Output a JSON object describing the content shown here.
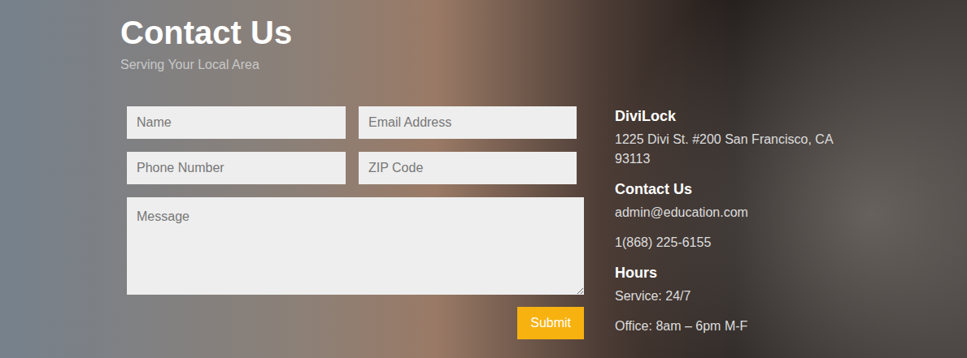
{
  "heading": {
    "title": "Contact Us",
    "subtitle": "Serving Your Local Area"
  },
  "form": {
    "fields": [
      {
        "placeholder": "Name"
      },
      {
        "placeholder": "Email Address"
      },
      {
        "placeholder": "Phone Number"
      },
      {
        "placeholder": "ZIP Code"
      }
    ],
    "message": {
      "placeholder": "Message"
    },
    "submit": "Submit"
  },
  "info": [
    {
      "title": "DiviLock",
      "lines": [
        "1225 Divi St. #200 San Francisco, CA 93113"
      ]
    },
    {
      "title": "Contact Us",
      "lines": [
        "admin@education.com",
        "1(868) 225-6155"
      ]
    },
    {
      "title": "Hours",
      "lines": [
        "Service: 24/7",
        "Office: 8am – 6pm M-F"
      ]
    }
  ]
}
